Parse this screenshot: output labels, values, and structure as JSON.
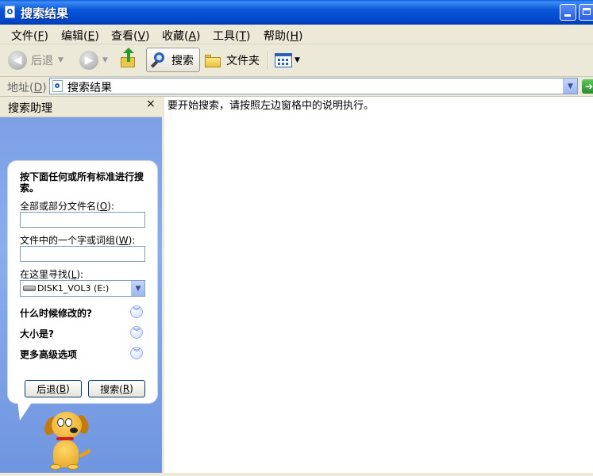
{
  "window": {
    "title": "搜索结果"
  },
  "menu": {
    "items": [
      {
        "label": "文件(",
        "key": "F",
        "tail": ")"
      },
      {
        "label": "编辑(",
        "key": "E",
        "tail": ")"
      },
      {
        "label": "查看(",
        "key": "V",
        "tail": ")"
      },
      {
        "label": "收藏(",
        "key": "A",
        "tail": ")"
      },
      {
        "label": "工具(",
        "key": "T",
        "tail": ")"
      },
      {
        "label": "帮助(",
        "key": "H",
        "tail": ")"
      }
    ]
  },
  "toolbar": {
    "back_label": "后退",
    "search_label": "搜索",
    "folders_label": "文件夹"
  },
  "address": {
    "label": "地址(",
    "key": "D",
    "tail": ")",
    "value": "搜索结果"
  },
  "search_pane": {
    "title": "搜索助理",
    "close": "×",
    "instruction": "按下面任何或所有标准进行搜索。",
    "name_label": "全部或部分文件名(",
    "name_key": "O",
    "name_tail": "):",
    "name_value": "",
    "word_label": "文件中的一个字或词组(",
    "word_key": "W",
    "word_tail": "):",
    "word_value": "",
    "look_in_label": "在这里寻找(",
    "look_in_key": "L",
    "look_in_tail": "):",
    "look_in_value": "DISK1_VOL3 (E:)",
    "options": [
      "什么时候修改的?",
      "大小是?",
      "更多高级选项"
    ],
    "back_button": "后退(",
    "back_key": "B",
    "search_button": "搜索(",
    "search_key": "R",
    "btn_tail": ")"
  },
  "content": {
    "message": "要开始搜索，请按照左边窗格中的说明执行。"
  }
}
